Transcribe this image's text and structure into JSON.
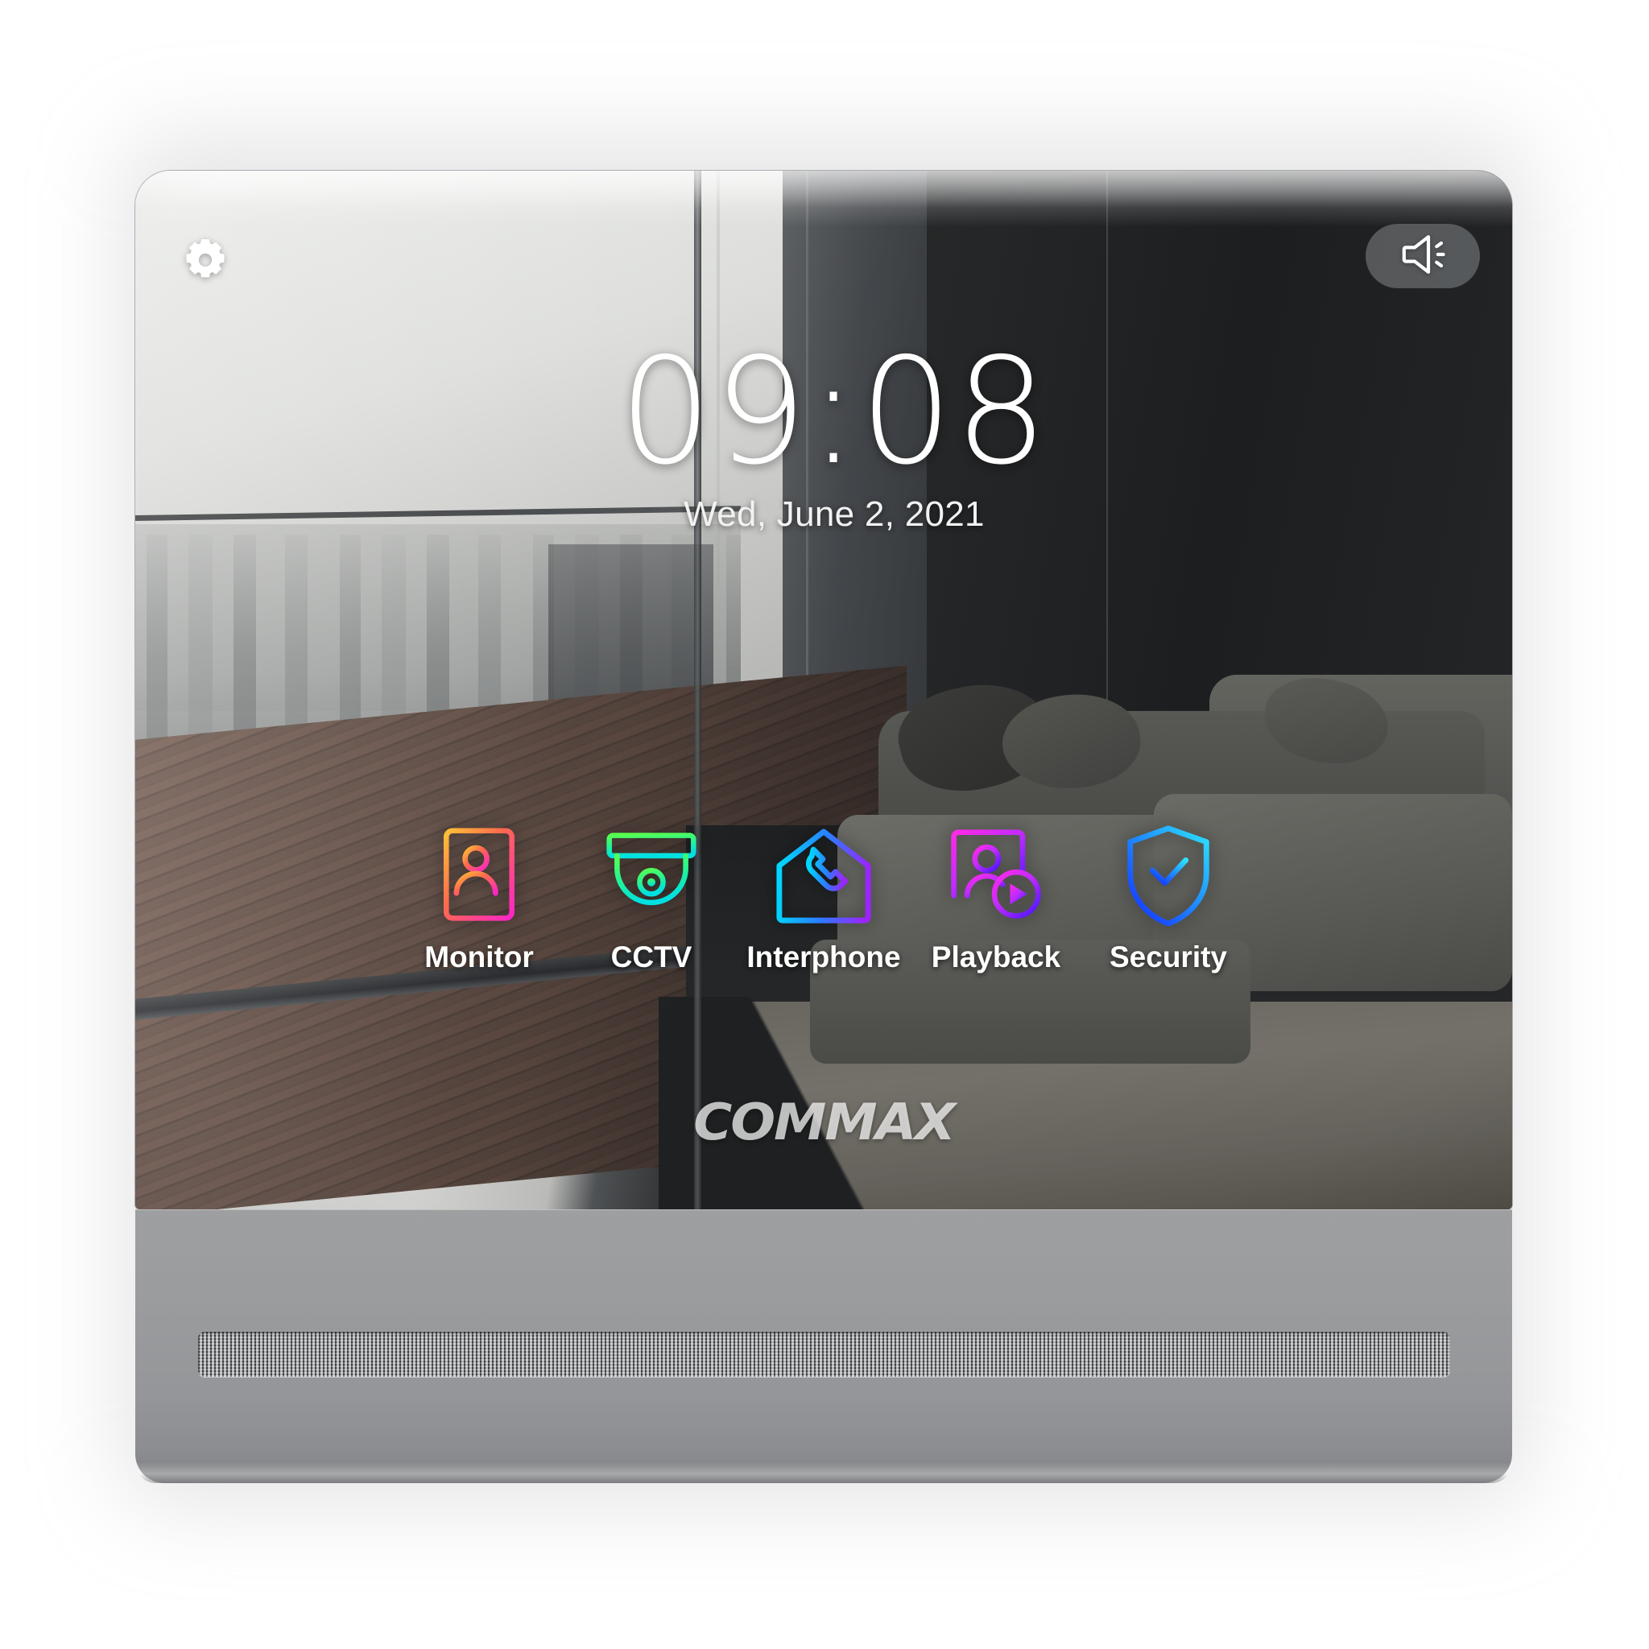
{
  "device": {
    "brand": "COMMAX",
    "type": "video-intercom-monitor"
  },
  "statusbar": {
    "settings_icon": "gear-icon",
    "volume_icon": "speaker-volume-icon"
  },
  "clock": {
    "time": "09:08",
    "date": "Wed, June 2, 2021"
  },
  "apps": [
    {
      "id": "monitor",
      "label": "Monitor",
      "icon": "door-station-monitor-icon",
      "gradient_from": "#ffb03a",
      "gradient_to": "#ff2ec4"
    },
    {
      "id": "cctv",
      "label": "CCTV",
      "icon": "dome-camera-icon",
      "gradient_from": "#4cff4c",
      "gradient_to": "#00e5d0"
    },
    {
      "id": "interphone",
      "label": "Interphone",
      "icon": "house-phone-icon",
      "gradient_from": "#00d2ff",
      "gradient_to": "#9b2bff"
    },
    {
      "id": "playback",
      "label": "Playback",
      "icon": "recording-playback-icon",
      "gradient_from": "#ff22e0",
      "gradient_to": "#5a1aff"
    },
    {
      "id": "security",
      "label": "Security",
      "icon": "shield-check-icon",
      "gradient_from": "#22d9ff",
      "gradient_to": "#1a47ff"
    }
  ],
  "colors": {
    "text_primary": "#ffffff",
    "pill_background": "rgba(132,134,136,0.55)",
    "bezel": "#9a9c9e"
  }
}
